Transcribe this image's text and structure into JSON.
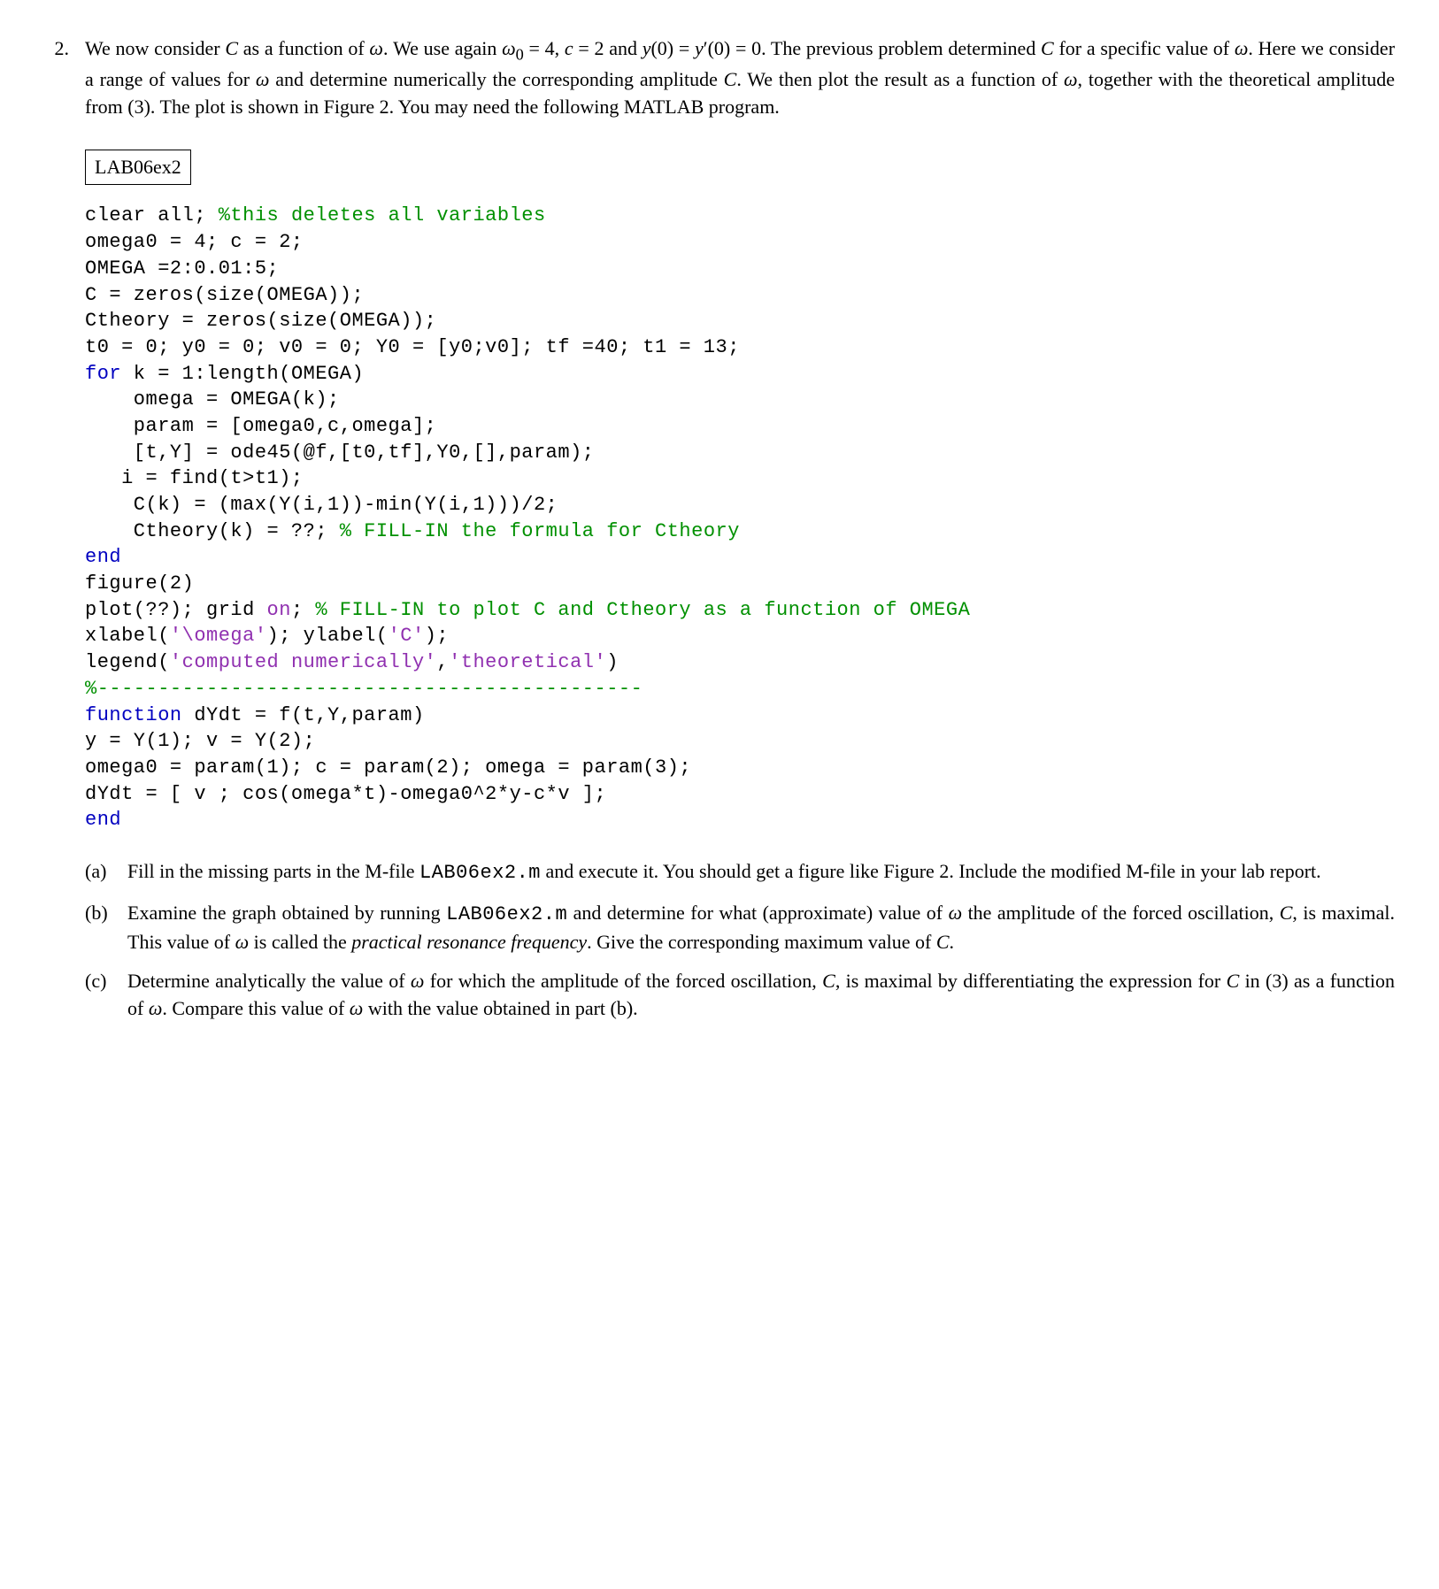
{
  "problem_number": "2.",
  "intro": "We now consider C as a function of ω. We use again ω₀ = 4, c = 2 and y(0) = y′(0) = 0. The previous problem determined C for a specific value of ω. Here we consider a range of values for ω and determine numerically the corresponding amplitude C. We then plot the result as a function of ω, together with the theoretical amplitude from (3). The plot is shown in Figure 2. You may need the following MATLAB program.",
  "file_label": "LAB06ex2",
  "code": {
    "l01a": "clear all; ",
    "l01b": "%this deletes all variables",
    "l02": "omega0 = 4; c = 2;",
    "l03": "OMEGA =2:0.01:5;",
    "l04": "C = zeros(size(OMEGA));",
    "l05": "Ctheory = zeros(size(OMEGA));",
    "l06": "t0 = 0; y0 = 0; v0 = 0; Y0 = [y0;v0]; tf =40; t1 = 13;",
    "l07a": "for",
    "l07b": " k = 1:length(OMEGA)",
    "l08": "    omega = OMEGA(k);",
    "l09": "    param = [omega0,c,omega];",
    "l10": "    [t,Y] = ode45(@f,[t0,tf],Y0,[],param);",
    "l11": "   i = find(t>t1);",
    "l12": "    C(k) = (max(Y(i,1))-min(Y(i,1)))/2;",
    "l13a": "    Ctheory(k) = ??; ",
    "l13b": "% FILL-IN the formula for Ctheory",
    "l14": "end",
    "l15": "figure(2)",
    "l16a": "plot(??); grid ",
    "l16b": "on",
    "l16c": "; ",
    "l16d": "% FILL-IN to plot C and Ctheory as a function of OMEGA",
    "l17a": "xlabel(",
    "l17b": "'\\omega'",
    "l17c": "); ylabel(",
    "l17d": "'C'",
    "l17e": ");",
    "l18a": "legend(",
    "l18b": "'computed numerically'",
    "l18c": ",",
    "l18d": "'theoretical'",
    "l18e": ")",
    "l19": "%---------------------------------------------",
    "l20a": "function",
    "l20b": " dYdt = f(t,Y,param)",
    "l21": "y = Y(1); v = Y(2);",
    "l22": "omega0 = param(1); c = param(2); omega = param(3);",
    "l23": "dYdt = [ v ; cos(omega*t)-omega0^2*y-c*v ];",
    "l24": "end"
  },
  "subparts": {
    "a": {
      "label": "(a)",
      "pre": "Fill in the missing parts in the M-file ",
      "file": "LAB06ex2.m",
      "post": " and execute it. You should get a figure like Figure 2. Include the modified M-file in your lab report."
    },
    "b": {
      "label": "(b)",
      "pre": "Examine the graph obtained by running ",
      "file": "LAB06ex2.m",
      "mid": " and determine for what (approximate) value of ω the amplitude of the forced oscillation, C, is maximal. This value of ω is called the ",
      "term": "practical resonance frequency",
      "post": ". Give the corresponding maximum value of C."
    },
    "c": {
      "label": "(c)",
      "text": "Determine analytically the value of ω for which the amplitude of the forced oscillation, C, is maximal by differentiating the expression for C in (3) as a function of ω. Compare this value of ω with the value obtained in part (b)."
    }
  }
}
